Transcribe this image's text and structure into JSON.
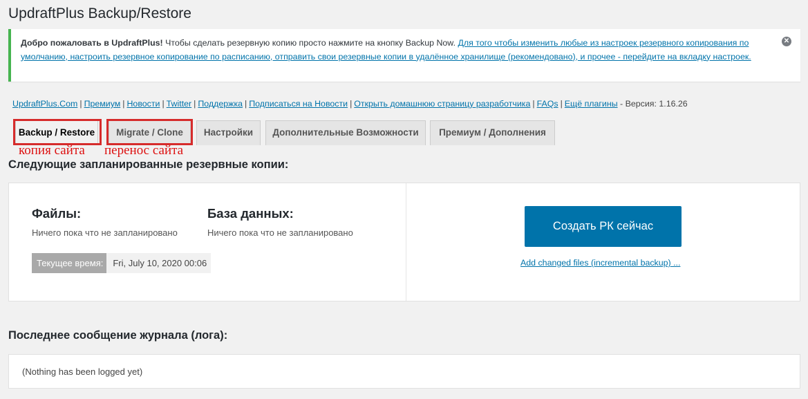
{
  "page": {
    "title": "UpdraftPlus Backup/Restore"
  },
  "notice": {
    "bold": "Добро пожаловать в UpdraftPlus!",
    "text": " Чтобы сделать резервную копию просто нажмите на кнопку Backup Now. ",
    "link": "Для того чтобы изменить любые из настроек резервного копирования по умолчанию, настроить резервное копирование по расписанию, отправить свои резервные копии в удалённое хранилище (рекомендовано), и прочее - перейдите на вкладку настроек."
  },
  "links": {
    "items": [
      "UpdraftPlus.Com",
      "Премиум",
      "Новости",
      "Twitter",
      "Поддержка",
      "Подписаться на Новости",
      "Открыть домашнюю страницу разработчика",
      "FAQs",
      "Ещё плагины"
    ],
    "version": " - Версия: 1.16.26"
  },
  "tabs": [
    {
      "label": "Backup / Restore",
      "active": true
    },
    {
      "label": "Migrate / Clone",
      "active": false
    },
    {
      "label": "Настройки",
      "active": false
    },
    {
      "label": "Дополнительные Возможности",
      "active": false
    },
    {
      "label": "Премиум / Дополнения",
      "active": false
    }
  ],
  "annotations": {
    "backup": "копия сайта",
    "migrate": "перенос сайта",
    "color": "#d62b2b"
  },
  "scheduled": {
    "heading": "Следующие запланированные резервные копии:",
    "files_title": "Файлы:",
    "files_text": "Ничего пока что не запланировано",
    "db_title": "База данных:",
    "db_text": "Ничего пока что не запланировано",
    "time_label": "Текущее время:",
    "time_value": "Fri, July 10, 2020 00:06",
    "backup_button": "Создать РК сейчас",
    "incremental_link": "Add changed files (incremental backup) ..."
  },
  "log": {
    "heading": "Последнее сообщение журнала (лога):",
    "text": "(Nothing has been logged yet)"
  },
  "colors": {
    "accent": "#0073aa",
    "notice_border": "#46b450"
  },
  "icons": {
    "dismiss": "dismiss-icon"
  }
}
